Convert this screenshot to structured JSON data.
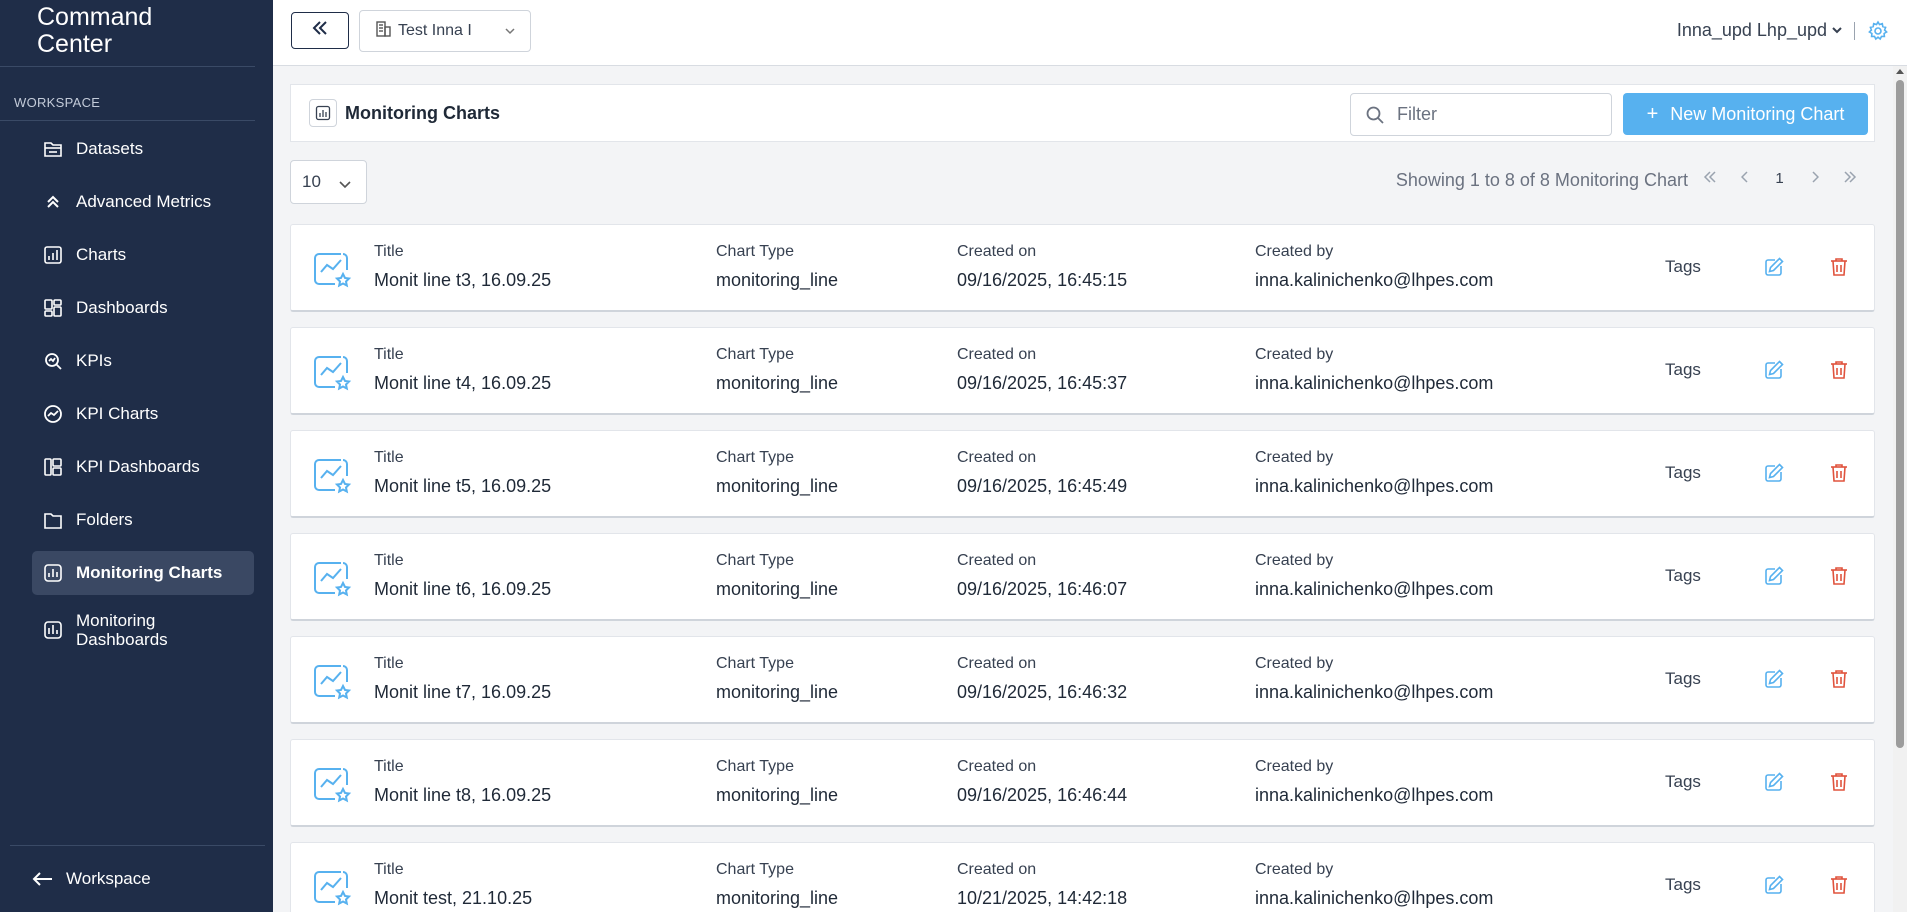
{
  "app": {
    "title_line1": "Command",
    "title_line2": "Center"
  },
  "sidebar": {
    "section_label": "WORKSPACE",
    "items": [
      {
        "label": "Datasets",
        "icon": "datasets-icon"
      },
      {
        "label": "Advanced Metrics",
        "icon": "chevrons-up-icon"
      },
      {
        "label": "Charts",
        "icon": "chart-icon"
      },
      {
        "label": "Dashboards",
        "icon": "dashboard-icon"
      },
      {
        "label": "KPIs",
        "icon": "kpi-search-icon"
      },
      {
        "label": "KPI Charts",
        "icon": "kpi-chart-icon"
      },
      {
        "label": "KPI Dashboards",
        "icon": "kpi-dashboard-icon"
      },
      {
        "label": "Folders",
        "icon": "folder-icon"
      },
      {
        "label": "Monitoring Charts",
        "icon": "monitoring-chart-icon",
        "active": true
      },
      {
        "label": "Monitoring Dashboards",
        "icon": "monitoring-dashboard-icon"
      }
    ],
    "footer_label": "Workspace"
  },
  "topbar": {
    "workspace_select": "Test Inna I",
    "user_name": "Inna_upd Lhp_upd"
  },
  "panel": {
    "title": "Monitoring Charts",
    "filter_placeholder": "Filter",
    "new_button": "New Monitoring Chart"
  },
  "pagination": {
    "page_size": "10",
    "showing": "Showing 1 to 8 of 8 Monitoring Chart",
    "current_page": "1"
  },
  "columns": {
    "title": "Title",
    "chart_type": "Chart Type",
    "created_on": "Created on",
    "created_by": "Created by",
    "tags": "Tags"
  },
  "rows": [
    {
      "title": "Monit line t3, 16.09.25",
      "chart_type": "monitoring_line",
      "created_on": "09/16/2025, 16:45:15",
      "created_by": "inna.kalinichenko@lhpes.com"
    },
    {
      "title": "Monit line t4, 16.09.25",
      "chart_type": "monitoring_line",
      "created_on": "09/16/2025, 16:45:37",
      "created_by": "inna.kalinichenko@lhpes.com"
    },
    {
      "title": "Monit line t5, 16.09.25",
      "chart_type": "monitoring_line",
      "created_on": "09/16/2025, 16:45:49",
      "created_by": "inna.kalinichenko@lhpes.com"
    },
    {
      "title": "Monit line t6, 16.09.25",
      "chart_type": "monitoring_line",
      "created_on": "09/16/2025, 16:46:07",
      "created_by": "inna.kalinichenko@lhpes.com"
    },
    {
      "title": "Monit line t7, 16.09.25",
      "chart_type": "monitoring_line",
      "created_on": "09/16/2025, 16:46:32",
      "created_by": "inna.kalinichenko@lhpes.com"
    },
    {
      "title": "Monit line t8, 16.09.25",
      "chart_type": "monitoring_line",
      "created_on": "09/16/2025, 16:46:44",
      "created_by": "inna.kalinichenko@lhpes.com"
    },
    {
      "title": "Monit test, 21.10.25",
      "chart_type": "monitoring_line",
      "created_on": "10/21/2025, 14:42:18",
      "created_by": "inna.kalinichenko@lhpes.com"
    }
  ],
  "colors": {
    "sidebar_bg": "#1f2d48",
    "accent": "#57b1ef",
    "delete": "#e0533d"
  }
}
